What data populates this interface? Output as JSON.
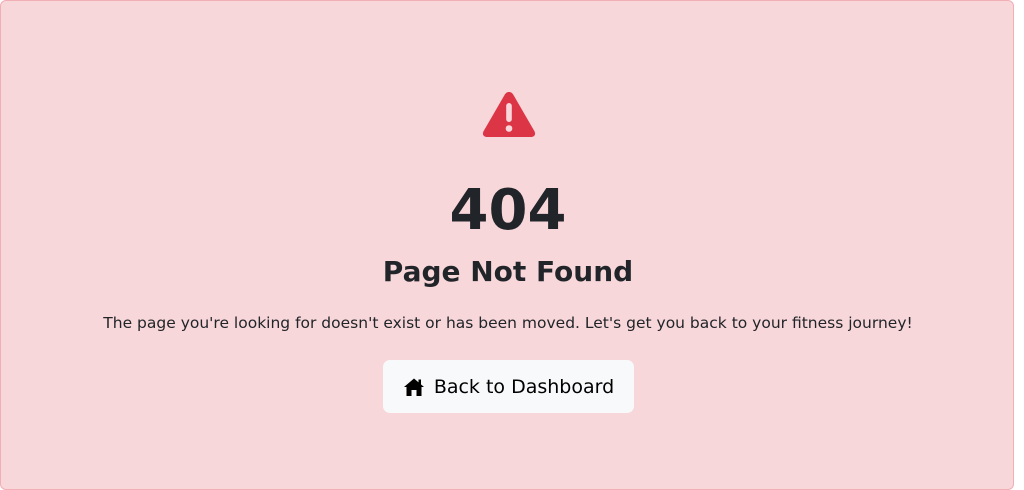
{
  "error": {
    "icon": "exclamation-triangle-icon",
    "code": "404",
    "title": "Page Not Found",
    "message": "The page you're looking for doesn't exist or has been moved. Let's get you back to your fitness journey!"
  },
  "actions": {
    "back_button": {
      "icon": "house-icon",
      "label": "Back to Dashboard"
    }
  },
  "colors": {
    "card_background": "#f8d7da",
    "card_border": "#f1aeb5",
    "icon_danger": "#dc3545",
    "text": "#212529",
    "button_background": "#f8f9fa"
  }
}
